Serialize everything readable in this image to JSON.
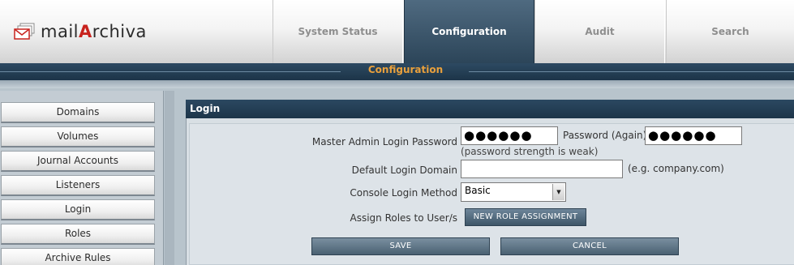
{
  "brand": {
    "logo_text_pre": "mail",
    "logo_text_accent": "A",
    "logo_text_post": "rchiva",
    "accent_color": "#c8231e"
  },
  "nav": {
    "tabs": [
      {
        "label": "System Status",
        "active": false
      },
      {
        "label": "Configuration",
        "active": true
      },
      {
        "label": "Audit",
        "active": false
      },
      {
        "label": "Search",
        "active": false
      }
    ]
  },
  "subheader": {
    "title": "Configuration"
  },
  "sidebar": {
    "items": [
      {
        "label": "Domains"
      },
      {
        "label": "Volumes"
      },
      {
        "label": "Journal Accounts"
      },
      {
        "label": "Listeners"
      },
      {
        "label": "Login"
      },
      {
        "label": "Roles"
      },
      {
        "label": "Archive Rules"
      }
    ]
  },
  "login": {
    "section_title": "Login",
    "master_password_label": "Master Admin Login Password",
    "master_password_value": "●●●●●●",
    "password_again_label": "Password (Again)",
    "password_again_value": "●●●●●●",
    "password_strength_note": "(password strength is weak)",
    "default_domain_label": "Default Login Domain",
    "default_domain_value": "",
    "default_domain_hint": "(e.g. company.com)",
    "console_method_label": "Console Login Method",
    "console_method_value": "Basic",
    "assign_roles_label": "Assign Roles to User/s",
    "new_role_button": "NEW ROLE ASSIGNMENT",
    "save_button": "SAVE",
    "cancel_button": "CANCEL"
  },
  "icons": {
    "logo": "envelope-stack-icon",
    "select_arrow": "chevron-down-icon"
  }
}
